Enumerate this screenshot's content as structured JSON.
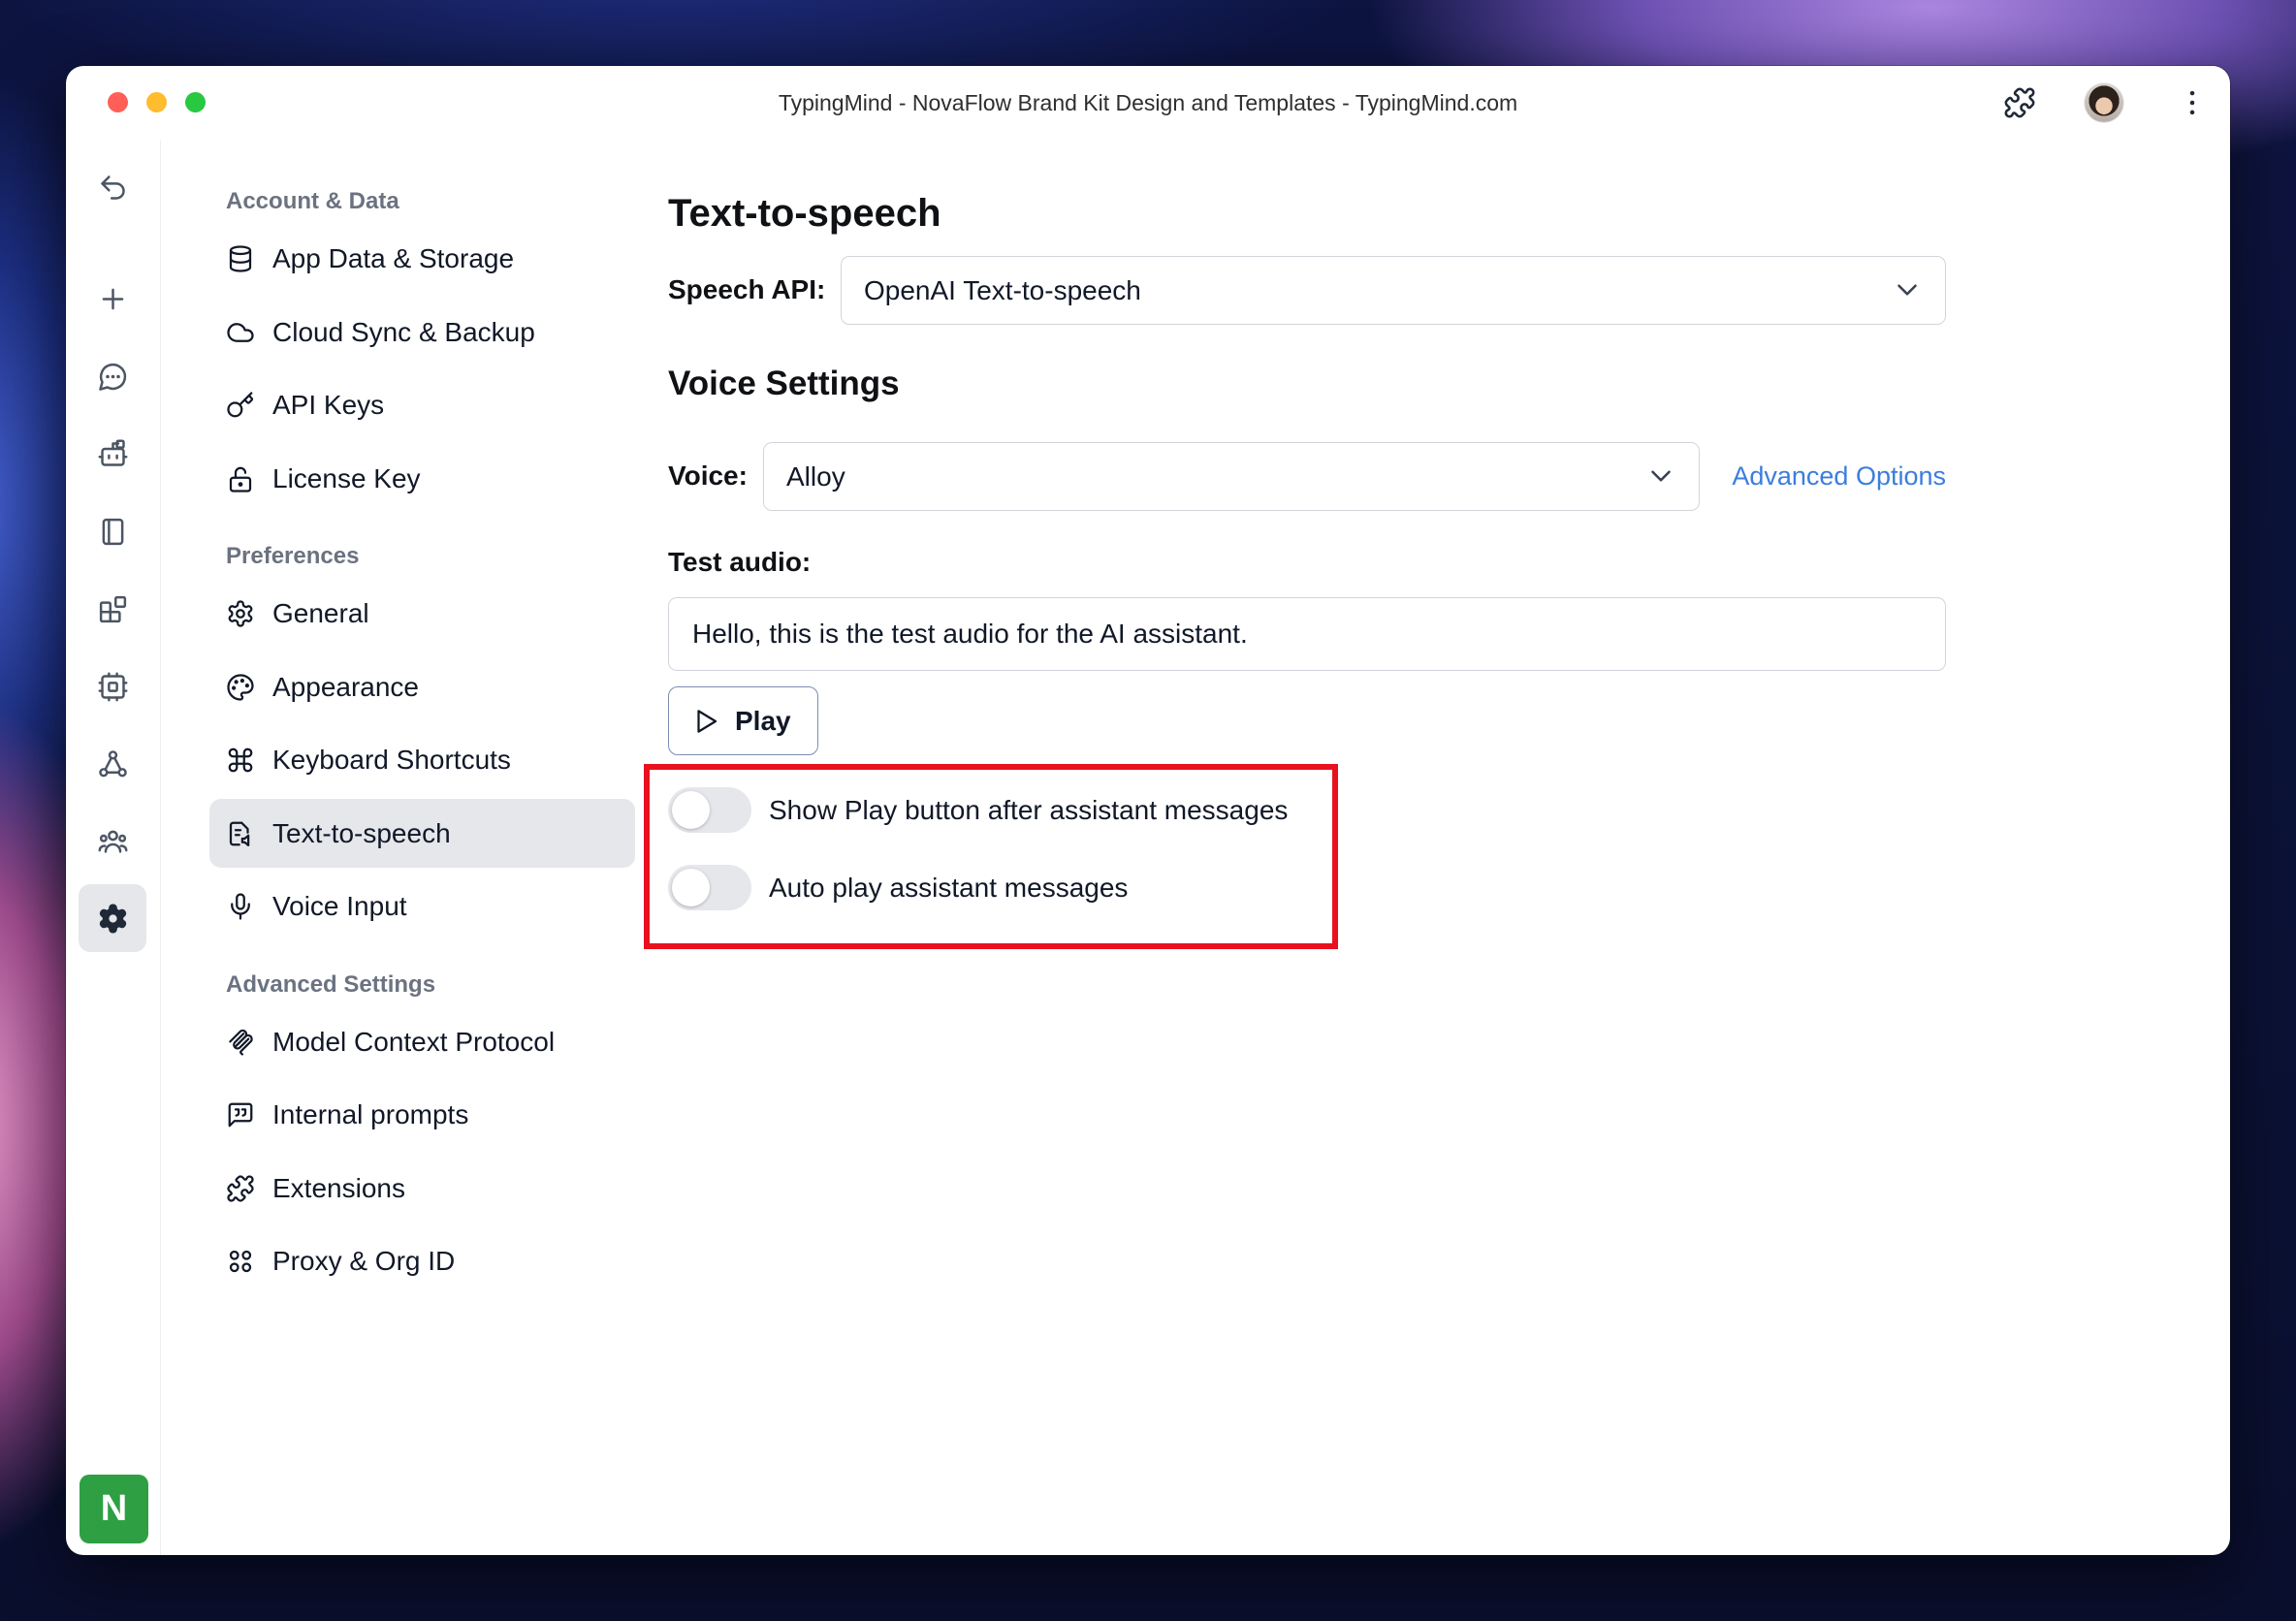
{
  "window": {
    "title": "TypingMind - NovaFlow Brand Kit Design and Templates - TypingMind.com",
    "traffic_lights": [
      "#ff5f57",
      "#febc2e",
      "#28c840"
    ]
  },
  "toolbar": {
    "icons": [
      "puzzle-icon",
      "user-avatar",
      "kebab-menu-icon"
    ]
  },
  "rail": {
    "icons": [
      "undo-icon",
      "plus-icon",
      "chat-icon",
      "bot-icon",
      "book-icon",
      "widgets-icon",
      "chip-icon",
      "network-icon",
      "team-icon",
      "gear-icon"
    ],
    "active": "gear-icon",
    "workspace_initial": "N",
    "workspace_color": "#2ea043"
  },
  "settings_nav": {
    "sections": [
      {
        "title": "Account & Data",
        "items": [
          {
            "label": "App Data & Storage",
            "icon": "database-icon"
          },
          {
            "label": "Cloud Sync & Backup",
            "icon": "cloud-icon"
          },
          {
            "label": "API Keys",
            "icon": "key-icon"
          },
          {
            "label": "License Key",
            "icon": "lock-icon"
          }
        ]
      },
      {
        "title": "Preferences",
        "items": [
          {
            "label": "General",
            "icon": "gear-icon"
          },
          {
            "label": "Appearance",
            "icon": "palette-icon"
          },
          {
            "label": "Keyboard Shortcuts",
            "icon": "command-icon"
          },
          {
            "label": "Text-to-speech",
            "icon": "text-to-speech-icon",
            "active": true
          },
          {
            "label": "Voice Input",
            "icon": "microphone-icon"
          }
        ]
      },
      {
        "title": "Advanced Settings",
        "items": [
          {
            "label": "Model Context Protocol",
            "icon": "mcp-icon"
          },
          {
            "label": "Internal prompts",
            "icon": "quote-bubble-icon"
          },
          {
            "label": "Extensions",
            "icon": "puzzle-icon"
          },
          {
            "label": "Proxy & Org ID",
            "icon": "proxy-icon"
          }
        ]
      }
    ]
  },
  "tts": {
    "title": "Text-to-speech",
    "speech_api": {
      "label": "Speech API:",
      "value": "OpenAI Text-to-speech"
    },
    "voice_settings_title": "Voice Settings",
    "voice": {
      "label": "Voice:",
      "value": "Alloy"
    },
    "advanced_options": "Advanced Options",
    "test_audio": {
      "label": "Test audio:",
      "value": "Hello, this is the test audio for the AI assistant."
    },
    "play_label": "Play",
    "toggles": [
      {
        "label": "Show Play button after assistant messages",
        "on": false
      },
      {
        "label": "Auto play assistant messages",
        "on": false
      }
    ]
  },
  "colors": {
    "link": "#3b7ddd",
    "highlight": "#e8121e",
    "active_bg": "#e5e7eb",
    "toggle_off": "#e5e7eb"
  }
}
